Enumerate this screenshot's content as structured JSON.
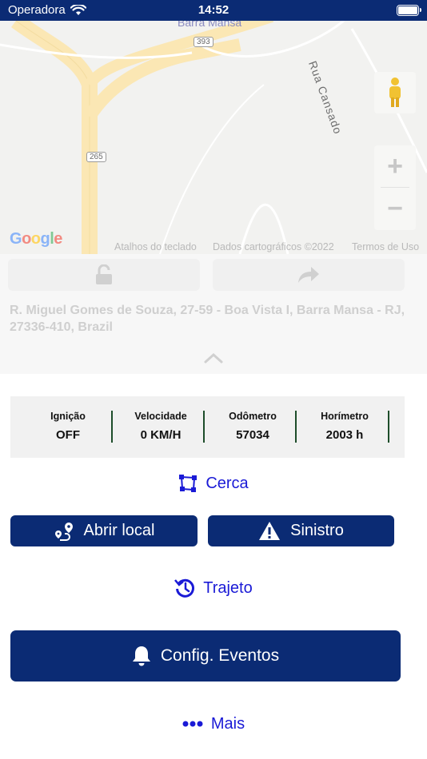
{
  "status_bar": {
    "carrier": "Operadora",
    "time": "14:52"
  },
  "map": {
    "city_label": "Barra Mansa",
    "street_label": "Rua Cansado",
    "route_shield_1": "393",
    "route_shield_2": "265",
    "google_logo": "Google",
    "footer_shortcuts": "Atalhos do teclado",
    "footer_data": "Dados cartográficos ©2022",
    "footer_terms": "Termos de Uso"
  },
  "address": "R. Miguel Gomes de Souza, 27-59 - Boa Vista I, Barra Mansa - RJ, 27336-410, Brazil",
  "telemetry": [
    {
      "label": "Ignição",
      "value": "OFF"
    },
    {
      "label": "Velocidade",
      "value": "0 KM/H"
    },
    {
      "label": "Odômetro",
      "value": "57034"
    },
    {
      "label": "Horímetro",
      "value": "2003 h"
    }
  ],
  "actions": {
    "cerca": "Cerca",
    "abrir_local": "Abrir local",
    "sinistro": "Sinistro",
    "trajeto": "Trajeto",
    "config_eventos": "Config. Eventos",
    "mais": "Mais"
  },
  "colors": {
    "primary": "#0b2b74",
    "link": "#1a1ad6",
    "divider": "#1d4d2a"
  }
}
